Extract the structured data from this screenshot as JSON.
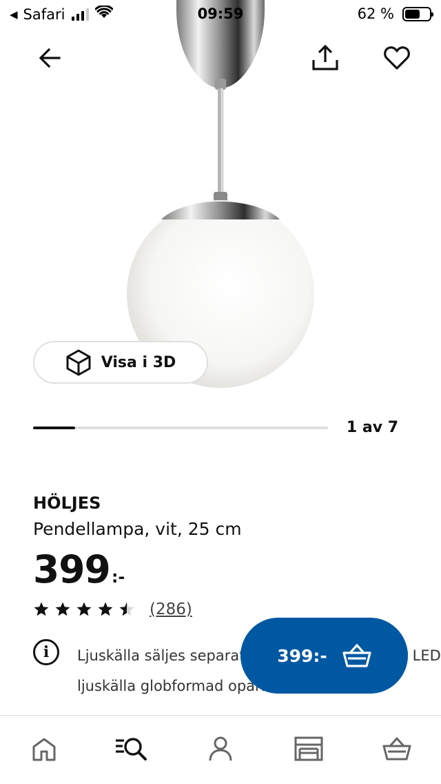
{
  "status_bar": {
    "back_app": "Safari",
    "time": "09:59",
    "battery": "62 %",
    "battery_level": 0.62
  },
  "product": {
    "name": "HÖLJES",
    "description": "Pendellampa, vit, 25 cm",
    "price": "399",
    "price_suffix": ":-",
    "rating_stars": 4.5,
    "rating_count": "(286)",
    "info_text": "Ljuskälla säljes separat. IKEA rekommenderar LED ljuskälla globformad opalvit."
  },
  "view_3d_label": "Visa i 3D",
  "carousel": {
    "label": "1 av 7",
    "current": 1,
    "total": 7
  },
  "cart_button": {
    "label": "399:-"
  },
  "icons": {
    "back": "arrow-left-icon",
    "share": "share-icon",
    "favorite": "heart-icon",
    "view3d": "cube-icon",
    "info": "info-icon",
    "cart": "basket-icon",
    "tabs": [
      "home-icon",
      "search-icon",
      "profile-icon",
      "store-icon",
      "basket-icon"
    ]
  },
  "colors": {
    "accent": "#0058a3",
    "text": "#111111",
    "divider": "#dfdfdf"
  }
}
